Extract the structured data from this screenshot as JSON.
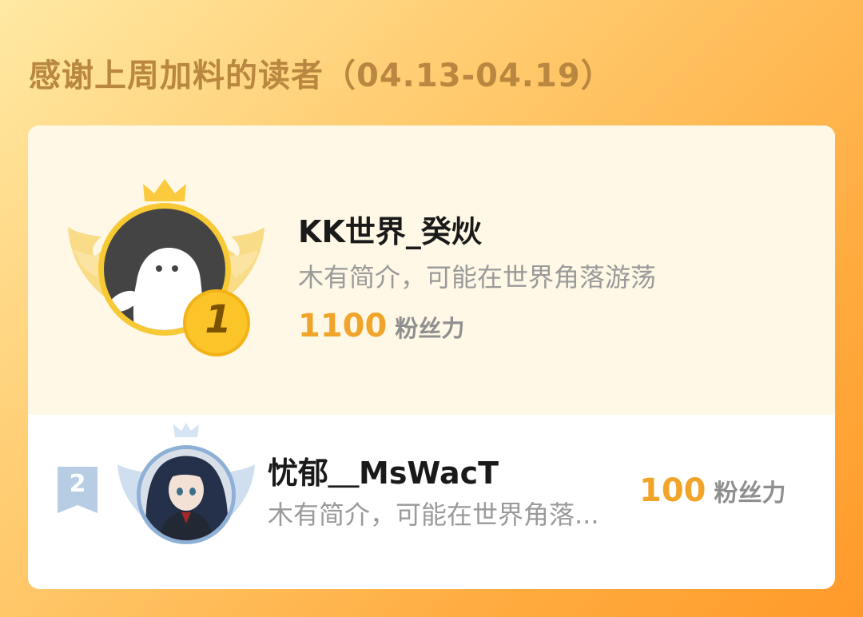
{
  "header": {
    "title": "感谢上周加料的读者（04.13-04.19）"
  },
  "ranking": [
    {
      "rank": "1",
      "name": "KK世界_癸炏",
      "bio": "木有简介，可能在世界角落游荡",
      "score": "1100",
      "score_unit": "粉丝力",
      "avatar_icon": "ghost-avatar-icon"
    },
    {
      "rank": "2",
      "name": "忧郁＿MsWacT",
      "bio": "木有简介，可能在世界角落...",
      "score": "100",
      "score_unit": "粉丝力",
      "avatar_icon": "anime-girl-avatar-icon"
    }
  ],
  "colors": {
    "accent_gold": "#f0a52a",
    "title_brown": "#b98740",
    "background_orange": "#ffab3f"
  }
}
